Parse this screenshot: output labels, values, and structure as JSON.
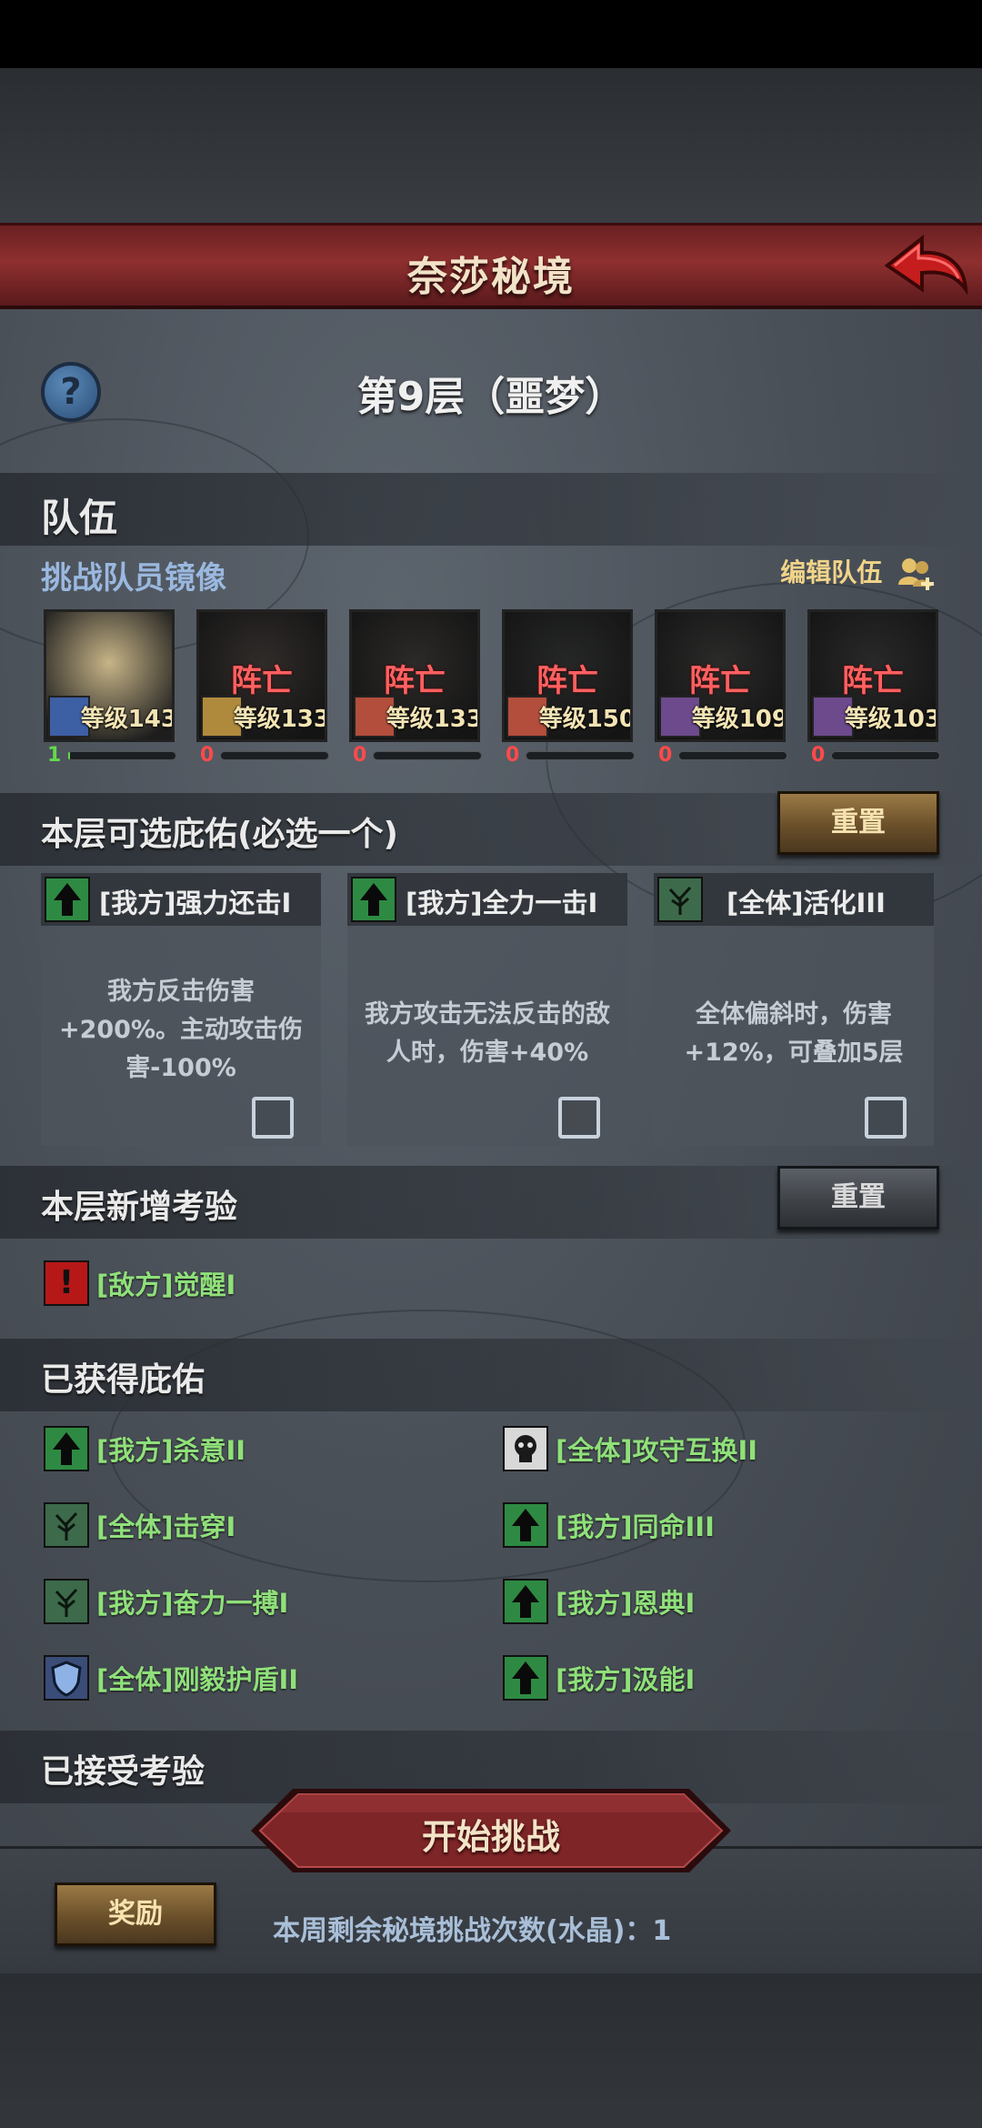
{
  "header": {
    "title": "奈莎秘境"
  },
  "floor": {
    "title": "第9层（噩梦）"
  },
  "team": {
    "section_title": "队伍",
    "subtitle": "挑战队员镜像",
    "edit_label": "编辑队伍",
    "members": [
      {
        "status": "",
        "level": "等级143",
        "count": "1",
        "num_color": "#62d94c",
        "bar": 0.02
      },
      {
        "status": "阵亡",
        "level": "等级133",
        "count": "0",
        "num_color": "#ff4a4a",
        "bar": 0
      },
      {
        "status": "阵亡",
        "level": "等级133",
        "count": "0",
        "num_color": "#ff4a4a",
        "bar": 0
      },
      {
        "status": "阵亡",
        "level": "等级150",
        "count": "0",
        "num_color": "#ff4a4a",
        "bar": 0
      },
      {
        "status": "阵亡",
        "level": "等级109",
        "count": "0",
        "num_color": "#ff4a4a",
        "bar": 0
      },
      {
        "status": "阵亡",
        "level": "等级103",
        "count": "0",
        "num_color": "#ff4a4a",
        "bar": 0
      }
    ]
  },
  "blessings_choice": {
    "title": "本层可选庇佑(必选一个)",
    "reset_label": "重置",
    "cards": [
      {
        "icon": "up-arrow-icon",
        "name": "[我方]强力还击I",
        "desc": "我方反击伤害+200%。主动攻击伤害-100%"
      },
      {
        "icon": "up-arrow-icon",
        "name": "[我方]全力一击I",
        "desc": "我方攻击无法反击的敌人时，伤害+40%"
      },
      {
        "icon": "tree-icon",
        "name": "[全体]活化III",
        "desc": "全体偏斜时，伤害+12%，可叠加5层"
      }
    ]
  },
  "trials_new": {
    "title": "本层新增考验",
    "reset_label": "重置",
    "items": [
      {
        "icon": "danger-icon",
        "name": "[敌方]觉醒I"
      }
    ]
  },
  "blessings_owned": {
    "title": "已获得庇佑",
    "items": [
      {
        "icon": "up-arrow-icon",
        "name": "[我方]杀意II"
      },
      {
        "icon": "skull-icon",
        "name": "[全体]攻守互换II"
      },
      {
        "icon": "tree-icon",
        "name": "[全体]击穿I"
      },
      {
        "icon": "up-arrow-icon",
        "name": "[我方]同命III"
      },
      {
        "icon": "tree-icon",
        "name": "[我方]奋力一搏I"
      },
      {
        "icon": "up-arrow-icon",
        "name": "[我方]恩典I"
      },
      {
        "icon": "shield-icon",
        "name": "[全体]刚毅护盾II"
      },
      {
        "icon": "up-arrow-icon",
        "name": "[我方]汲能I"
      }
    ]
  },
  "trials_accepted": {
    "title": "已接受考验"
  },
  "footer": {
    "start_label": "开始挑战",
    "reward_label": "奖励",
    "remaining_text": "本周剩余秘境挑战次数(水晶)：1"
  }
}
